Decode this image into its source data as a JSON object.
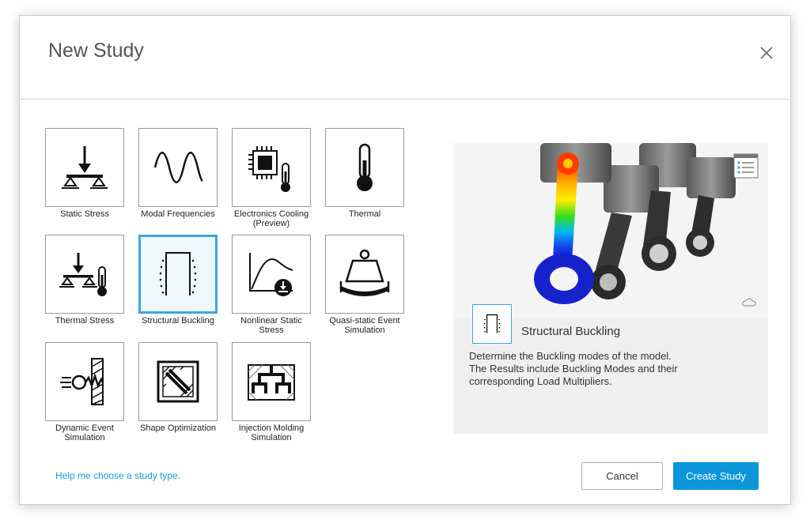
{
  "dialog": {
    "title": "New Study"
  },
  "tiles": [
    {
      "label": "Static Stress"
    },
    {
      "label": "Modal Frequencies"
    },
    {
      "label": "Electronics Cooling\n(Preview)"
    },
    {
      "label": "Thermal"
    },
    {
      "label": "Thermal Stress"
    },
    {
      "label": "Structural Buckling"
    },
    {
      "label": "Nonlinear Static\nStress"
    },
    {
      "label": "Quasi-static Event\nSimulation"
    },
    {
      "label": "Dynamic Event\nSimulation"
    },
    {
      "label": "Shape Optimization"
    },
    {
      "label": "Injection Molding\nSimulation"
    }
  ],
  "selected_index": 5,
  "preview": {
    "name": "Structural Buckling",
    "description": "Determine the Buckling modes of the model.\nThe Results include Buckling Modes and their\ncorresponding Load Multipliers."
  },
  "footer": {
    "help_link": "Help me choose a study type.",
    "cancel_label": "Cancel",
    "create_label": "Create Study"
  },
  "colors": {
    "accent": "#0a96d9",
    "selection_border": "#3aa7de",
    "link": "#1b9ad6"
  }
}
